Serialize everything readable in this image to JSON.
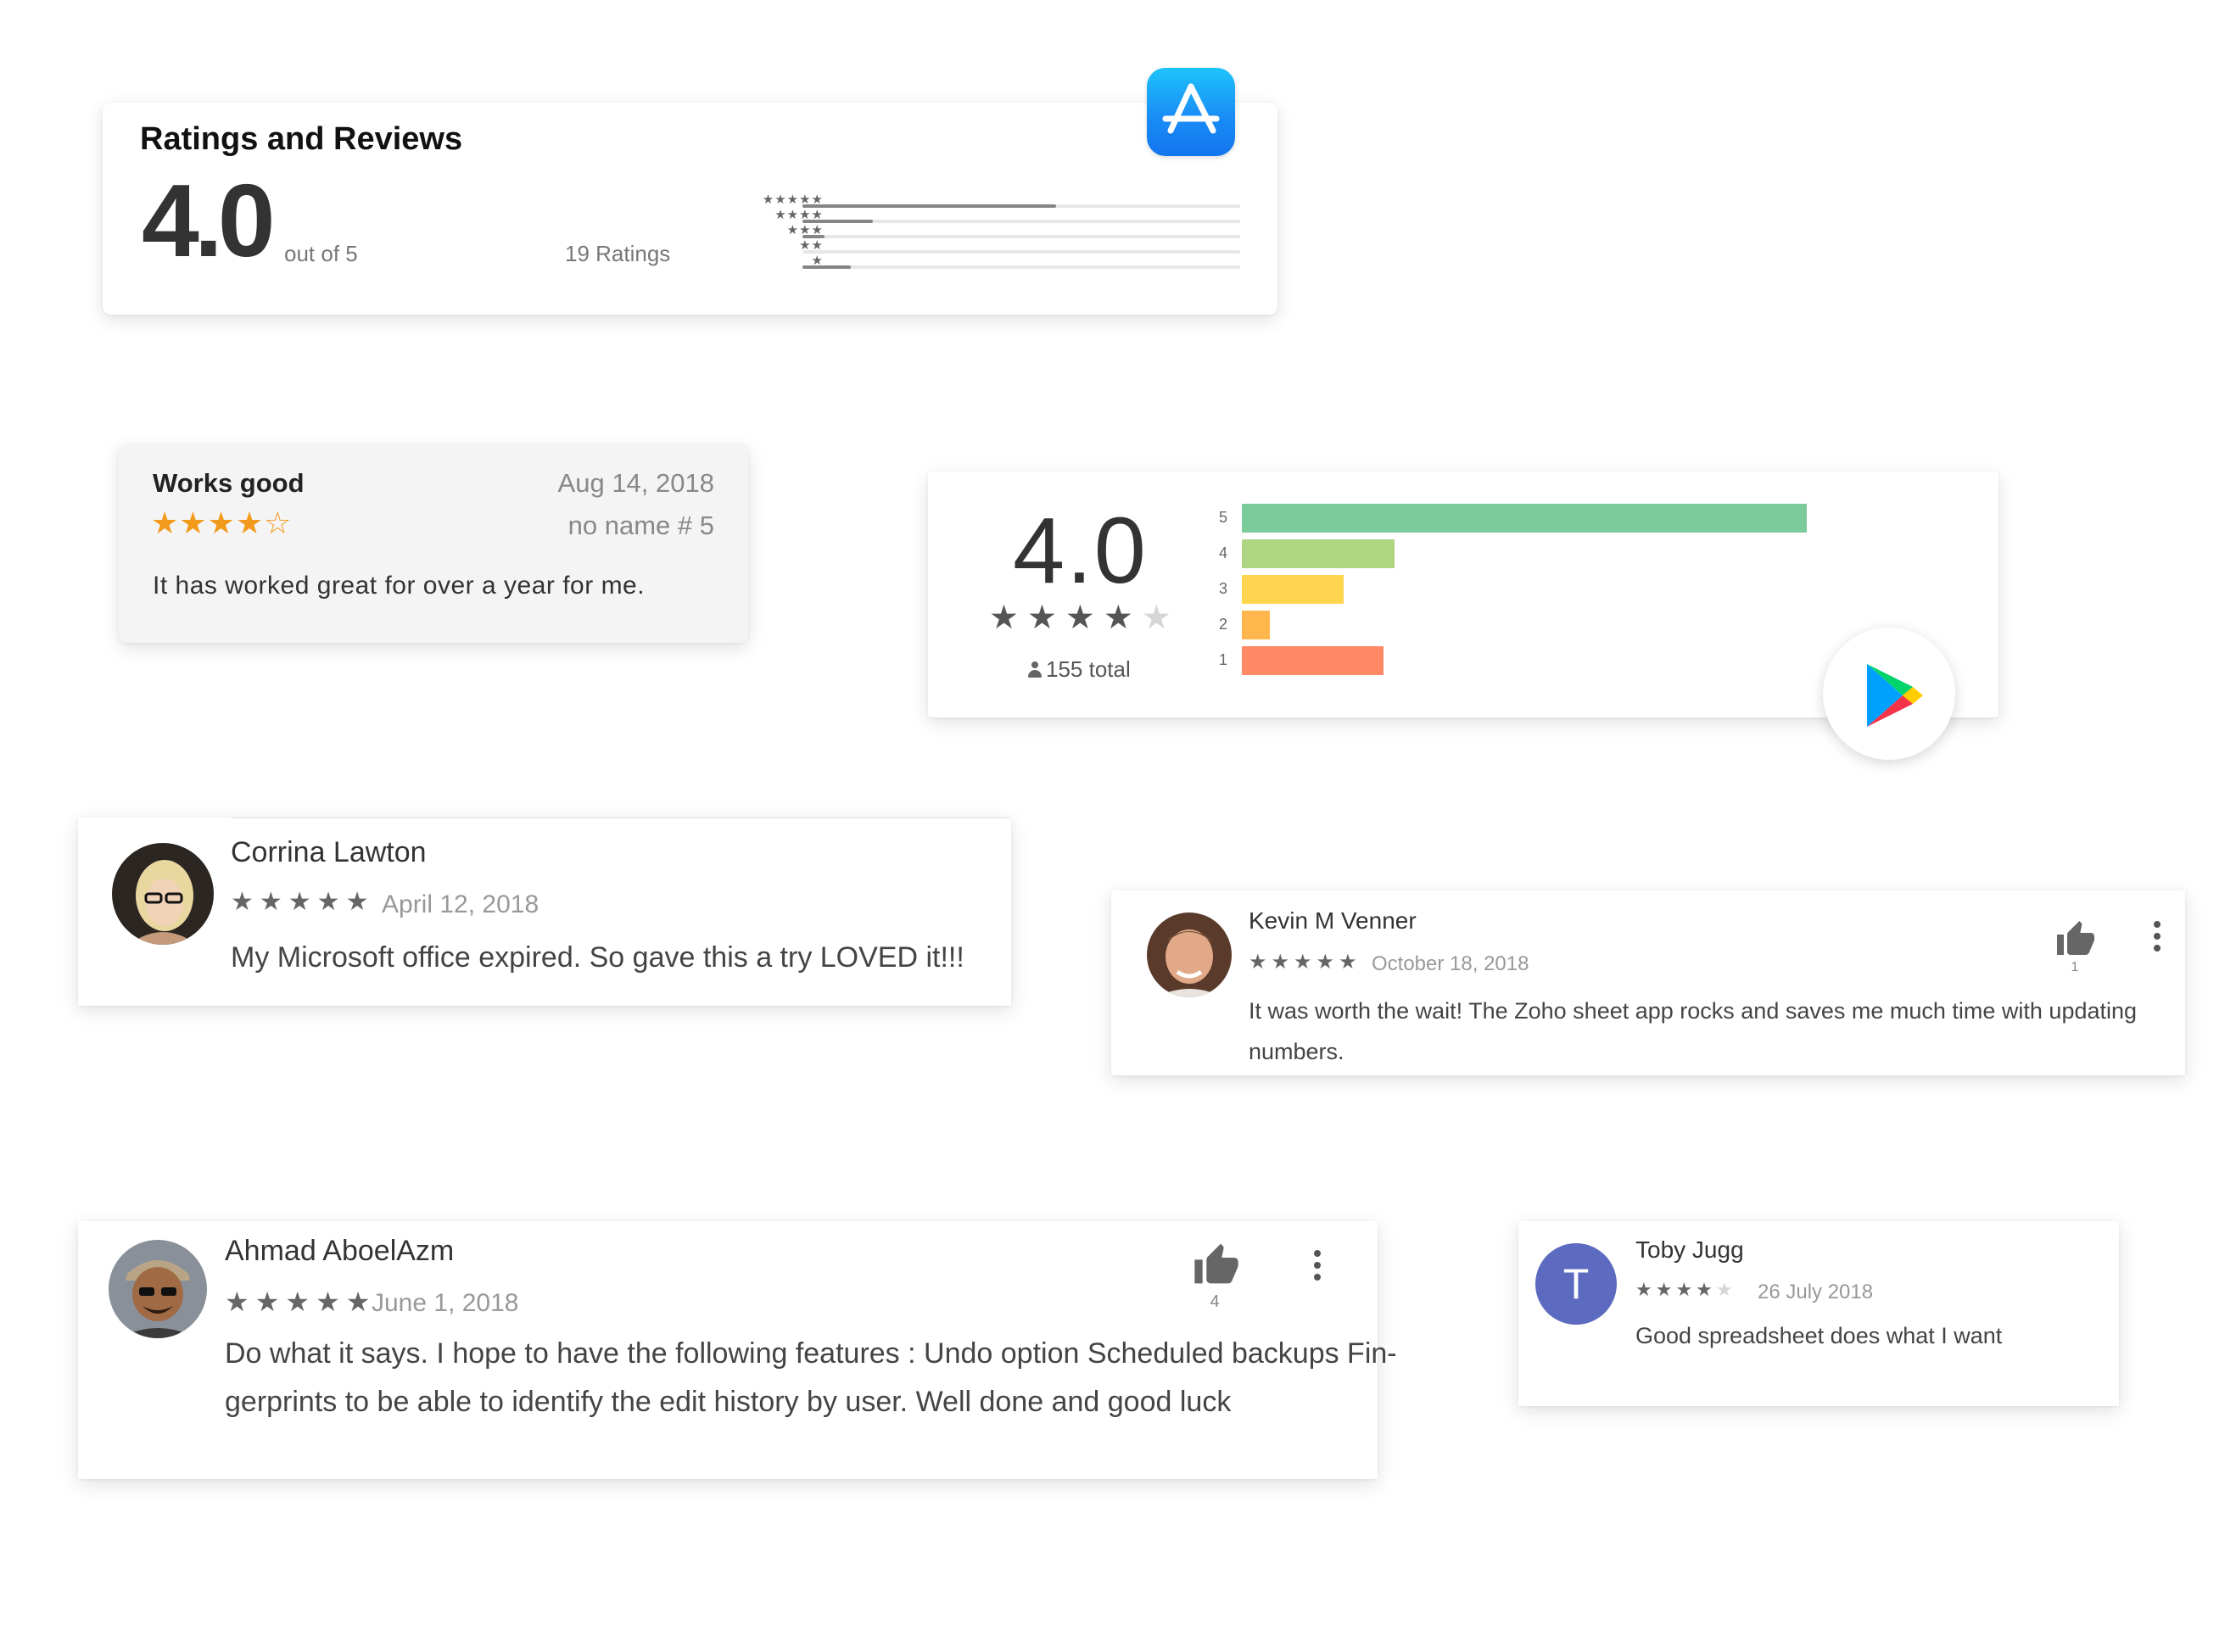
{
  "appstore_summary": {
    "title": "Ratings and Reviews",
    "average": "4.0",
    "out_of": "out of 5",
    "ratings_count": "19 Ratings",
    "star_labels": [
      "★★★★★",
      "★★★★",
      "★★★",
      "★★",
      "★"
    ],
    "distribution_fractions": [
      0.58,
      0.16,
      0.05,
      0.0,
      0.11
    ],
    "icon": "app-store-icon"
  },
  "appstore_review": {
    "title": "Works good",
    "date": "Aug 14, 2018",
    "stars": "★★★★☆",
    "rating": 4,
    "author": "no name # 5",
    "body": "It has worked great for over a year for me.",
    "star_color": "#f19a1c"
  },
  "play_summary": {
    "average": "4.0",
    "stars_on": "★★★★",
    "stars_off": "★",
    "rating": 4,
    "total": "155 total",
    "bars": [
      {
        "label": "5",
        "fraction": 1.0,
        "color": "#7bcb9b"
      },
      {
        "label": "4",
        "fraction": 0.27,
        "color": "#aed581"
      },
      {
        "label": "3",
        "fraction": 0.18,
        "color": "#ffd54f"
      },
      {
        "label": "2",
        "fraction": 0.05,
        "color": "#ffb74d"
      },
      {
        "label": "1",
        "fraction": 0.25,
        "color": "#ff8a65"
      }
    ],
    "icon": "google-play-icon"
  },
  "reviews": {
    "corrina": {
      "name": "Corrina Lawton",
      "stars": "★★★★★",
      "rating": 5,
      "date": "April 12, 2018",
      "body": "My Microsoft office expired. So gave this a try LOVED it!!!"
    },
    "kevin": {
      "name": "Kevin M Venner",
      "stars": "★★★★★",
      "rating": 5,
      "date": "October 18, 2018",
      "body": "It was worth the wait! The Zoho sheet app rocks and saves me much time with updating numbers.",
      "thumbs_up": "1"
    },
    "ahmad": {
      "name": "Ahmad AboelAzm",
      "stars": "★★★★★",
      "rating": 5,
      "date": "June 1, 2018",
      "body": "Do what it says. I hope to have the following features : Undo option Scheduled backups Fin-gerprints to be able to identify the edit history by user. Well done and good luck",
      "thumbs_up": "4"
    },
    "toby": {
      "name": "Toby Jugg",
      "avatar_letter": "T",
      "avatar_color": "#5c6bc0",
      "stars_on": "★★★★",
      "stars_off": "★",
      "rating": 4,
      "date": "26 July 2018",
      "body": "Good spreadsheet does what I want"
    }
  }
}
